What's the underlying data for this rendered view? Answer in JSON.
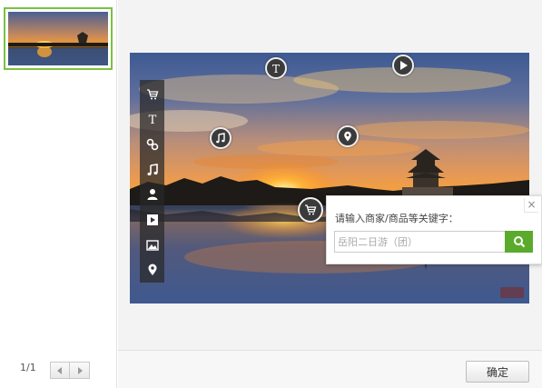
{
  "pager": {
    "text": "1/1",
    "prev_icon": "prev-arrow-icon",
    "next_icon": "next-arrow-icon"
  },
  "footer": {
    "ok_label": "确定"
  },
  "toolbar": {
    "items": [
      {
        "name": "cart-icon"
      },
      {
        "name": "text-icon",
        "glyph": "T"
      },
      {
        "name": "link-icon"
      },
      {
        "name": "music-icon"
      },
      {
        "name": "person-icon"
      },
      {
        "name": "video-icon"
      },
      {
        "name": "image-icon"
      },
      {
        "name": "location-icon"
      }
    ]
  },
  "hotspots": {
    "text_glyph": "T"
  },
  "popup": {
    "label": "请输入商家/商品等关键字：",
    "input_value": "岳阳二日游（团）",
    "close_glyph": "×"
  },
  "colors": {
    "accent_green": "#5aab2c",
    "thumb_border": "#7bc142"
  }
}
